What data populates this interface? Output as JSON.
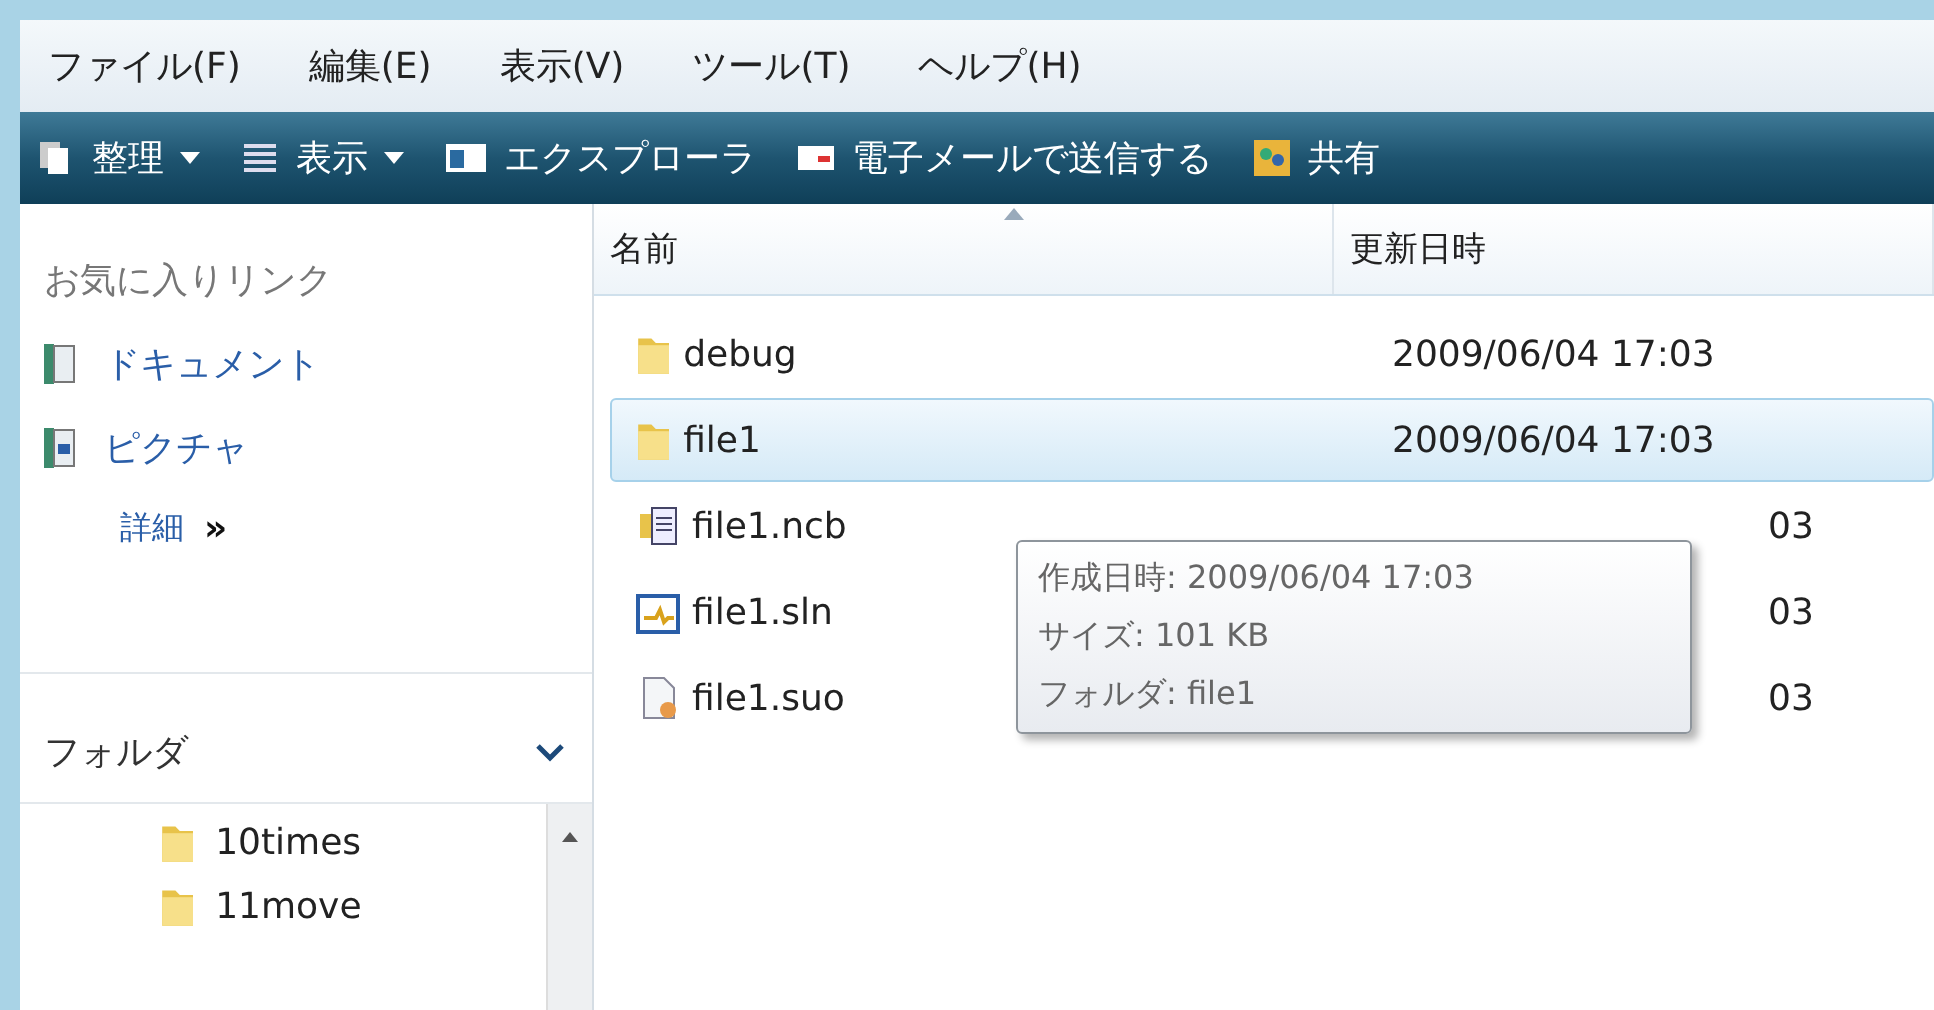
{
  "menu": [
    "ファイル(F)",
    "編集(E)",
    "表示(V)",
    "ツール(T)",
    "ヘルプ(H)"
  ],
  "toolbar": [
    {
      "label": "整理",
      "kind": "organize",
      "dropdown": true
    },
    {
      "label": "表示",
      "kind": "views",
      "dropdown": true
    },
    {
      "label": "エクスプローラ",
      "kind": "explorer",
      "dropdown": false
    },
    {
      "label": "電子メールで送信する",
      "kind": "mail",
      "dropdown": false
    },
    {
      "label": "共有",
      "kind": "share",
      "dropdown": false
    }
  ],
  "sidebar": {
    "favorites_title": "お気に入りリンク",
    "links": [
      {
        "label": "ドキュメント",
        "kind": "documents"
      },
      {
        "label": "ピクチャ",
        "kind": "pictures"
      }
    ],
    "more": {
      "label": "詳細",
      "arrow": "»"
    },
    "folders_title": "フォルダ",
    "folders": [
      "10times",
      "11move"
    ]
  },
  "table": {
    "columns": [
      "名前",
      "更新日時"
    ],
    "rows": [
      {
        "name": "debug",
        "kind": "folder",
        "modified": "2009/06/04 17:03",
        "selected": false,
        "covered": false
      },
      {
        "name": "file1",
        "kind": "folder",
        "modified": "2009/06/04 17:03",
        "selected": true,
        "covered": false
      },
      {
        "name": "file1.ncb",
        "kind": "ncb",
        "modified": "03",
        "selected": false,
        "covered": true
      },
      {
        "name": "file1.sln",
        "kind": "sln",
        "modified": "03",
        "selected": false,
        "covered": true
      },
      {
        "name": "file1.suo",
        "kind": "suo",
        "modified": "03",
        "selected": false,
        "covered": true
      }
    ]
  },
  "tooltip": [
    "作成日時: 2009/06/04 17:03",
    "サイズ: 101 KB",
    "フォルダ: file1"
  ]
}
